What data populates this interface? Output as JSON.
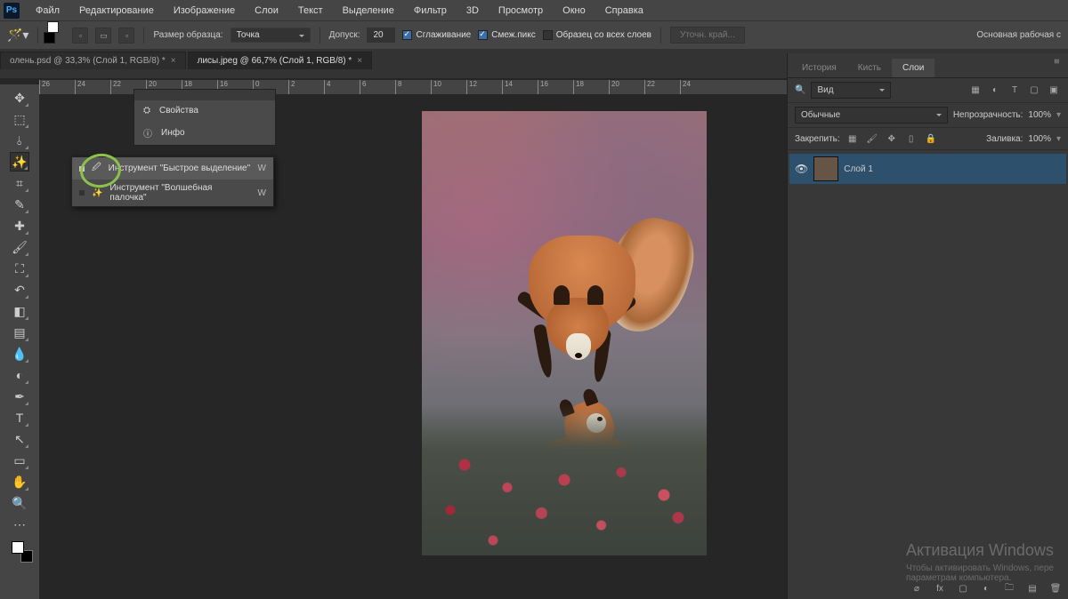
{
  "menubar": {
    "logo": "Ps",
    "items": [
      "Файл",
      "Редактирование",
      "Изображение",
      "Слои",
      "Текст",
      "Выделение",
      "Фильтр",
      "3D",
      "Просмотр",
      "Окно",
      "Справка"
    ]
  },
  "options": {
    "sample_label": "Размер образца:",
    "sample_value": "Точка",
    "tolerance_label": "Допуск:",
    "tolerance_value": "20",
    "anti_alias": "Сглаживание",
    "contiguous": "Смеж.пикс",
    "all_layers": "Образец со всех слоев",
    "refine": "Уточн. край...",
    "workspace": "Основная рабочая с"
  },
  "tabs": {
    "t1": "олень.psd @ 33,3% (Слой 1, RGB/8) *",
    "t2": "лисы.jpeg @ 66,7% (Слой 1, RGB/8) *"
  },
  "ruler": [
    "26",
    "24",
    "22",
    "20",
    "18",
    "16",
    "0",
    "2",
    "4",
    "6",
    "8",
    "10",
    "12",
    "14",
    "16",
    "18",
    "20",
    "22",
    "24"
  ],
  "flyout": {
    "quick": "Инструмент \"Быстрое выделение\"",
    "wand": "Инструмент \"Волшебная палочка\"",
    "key": "W"
  },
  "propcard": {
    "hdr": "",
    "props": "Свойства",
    "info": "Инфо"
  },
  "panels": {
    "history": "История",
    "brush": "Кисть",
    "layers": "Слои",
    "kind_label": "Вид",
    "blend": "Обычные",
    "opacity_label": "Непрозрачность:",
    "opacity_value": "100%",
    "lock_label": "Закрепить:",
    "fill_label": "Заливка:",
    "fill_value": "100%",
    "layer1": "Слой 1"
  },
  "watermark": {
    "title": "Активация Windows",
    "line1": "Чтобы активировать Windows, пере",
    "line2": "параметрам компьютера."
  }
}
